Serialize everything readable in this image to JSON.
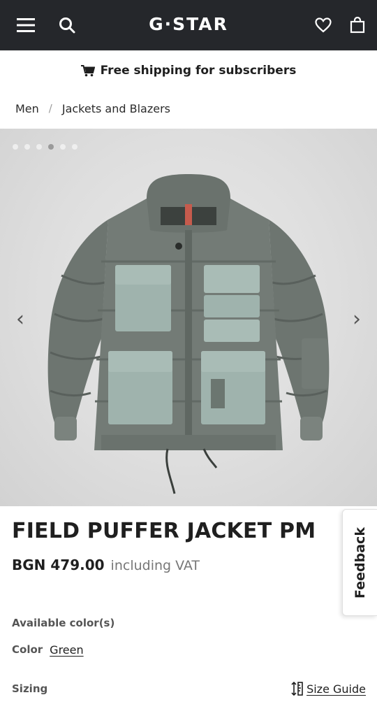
{
  "header": {
    "menu_icon": "hamburger-menu-icon",
    "search_icon": "search-icon",
    "logo_text": "G·STAR",
    "wishlist_icon": "heart-icon",
    "bag_icon": "shopping-bag-icon",
    "bg_color": "#25272b"
  },
  "promo": {
    "icon": "cart-icon",
    "text": "Free shipping for subscribers"
  },
  "breadcrumb": {
    "items": [
      "Men",
      "Jackets and Blazers"
    ],
    "separator": "/"
  },
  "gallery": {
    "slide_count": 6,
    "active_index": 3,
    "prev_arrow": "‹",
    "next_arrow": "›"
  },
  "product": {
    "title": "FIELD PUFFER JACKET PM",
    "price": "BGN 479.00",
    "vat_note": "including VAT",
    "available_colors_label": "Available color(s)",
    "color_label": "Color",
    "color_value": "Green",
    "sizing_label": "Sizing",
    "size_guide_label": "Size Guide"
  },
  "feedback": {
    "label": "Feedback"
  }
}
